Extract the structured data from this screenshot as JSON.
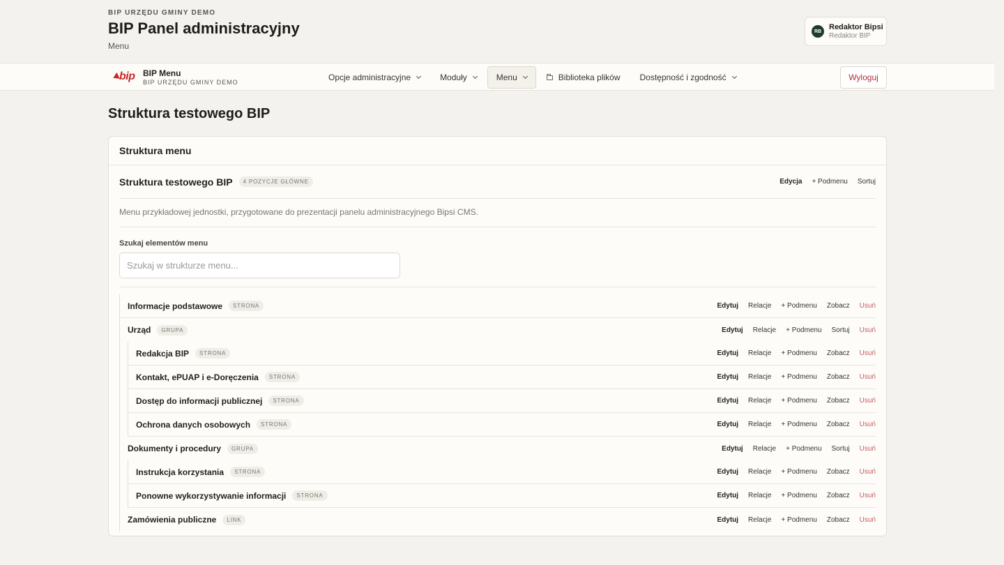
{
  "header": {
    "org": "BIP URZĘDU GMINY DEMO",
    "title": "BIP Panel administracyjny",
    "subtitle": "Menu"
  },
  "user": {
    "initials": "RB",
    "name": "Redaktor Bipsi",
    "role": "Redaktor BIP"
  },
  "nav": {
    "logo_mark": "bip",
    "logo_title": "BIP Menu",
    "logo_subtitle": "BIP URZĘDU GMINY DEMO",
    "items": [
      {
        "label": "Opcje administracyjne"
      },
      {
        "label": "Moduły"
      },
      {
        "label": "Menu"
      },
      {
        "label": "Biblioteka plików"
      },
      {
        "label": "Dostępność i zgodność"
      }
    ],
    "logout": "Wyloguj"
  },
  "page": {
    "title": "Struktura testowego BIP"
  },
  "panel": {
    "heading": "Struktura menu",
    "menu_name": "Struktura testowego BIP",
    "menu_badge": "4 POZYCJE GŁÓWNE",
    "menu_actions": [
      "Edycja",
      "+ Podmenu",
      "Sortuj"
    ],
    "description": "Menu przykładowej jednostki, przygotowane do prezentacji panelu administracyjnego Bipsi CMS.",
    "search_label": "Szukaj elementów menu",
    "search_placeholder": "Szukaj w strukturze menu...",
    "search_value": ""
  },
  "actions": {
    "edit": "Edytuj",
    "relations": "Relacje",
    "submenu": "+ Podmenu",
    "view": "Zobacz",
    "sort": "Sortuj",
    "delete": "Usuń"
  },
  "tree": [
    {
      "name": "Informacje podstawowe",
      "type": "STRONA"
    },
    {
      "name": "Urząd",
      "type": "GRUPA",
      "children": [
        {
          "name": "Redakcja BIP",
          "type": "STRONA"
        },
        {
          "name": "Kontakt, ePUAP i e-Doręczenia",
          "type": "STRONA"
        },
        {
          "name": "Dostęp do informacji publicznej",
          "type": "STRONA"
        },
        {
          "name": "Ochrona danych osobowych",
          "type": "STRONA"
        }
      ]
    },
    {
      "name": "Dokumenty i procedury",
      "type": "GRUPA",
      "children": [
        {
          "name": "Instrukcja korzystania",
          "type": "STRONA"
        },
        {
          "name": "Ponowne wykorzystywanie informacji",
          "type": "STRONA"
        }
      ]
    },
    {
      "name": "Zamówienia publiczne",
      "type": "LINK"
    }
  ]
}
